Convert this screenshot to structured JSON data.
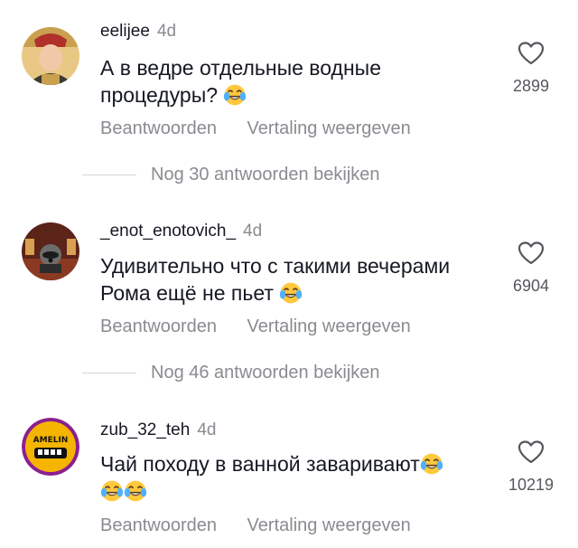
{
  "comments": [
    {
      "username": "eelijee",
      "time": "4d",
      "text": "А в ведре отдельные водные процедуры?",
      "like_count": "2899",
      "reply_label": "Beantwoorden",
      "translate_label": "Vertaling weergeven",
      "more_replies": "Nog 30 antwoorden bekijken"
    },
    {
      "username": "_enot_enotovich_",
      "time": "4d",
      "text": "Удивительно что с такими вечерами Рома ещё не пьет",
      "like_count": "6904",
      "reply_label": "Beantwoorden",
      "translate_label": "Vertaling weergeven",
      "more_replies": "Nog 46 antwoorden bekijken"
    },
    {
      "username": "zub_32_teh",
      "time": "4d",
      "text": "Чай походу в ванной заваривают",
      "like_count": "10219",
      "reply_label": "Beantwoorden",
      "translate_label": "Vertaling weergeven",
      "avatar_logo_text": "AMELIN"
    }
  ],
  "icons": {
    "like": "heart-outline-icon",
    "emoji": "tears-of-joy-emoji"
  },
  "colors": {
    "muted": "#8a8b91",
    "text": "#161823",
    "emoji_face": "#ffc83d"
  }
}
